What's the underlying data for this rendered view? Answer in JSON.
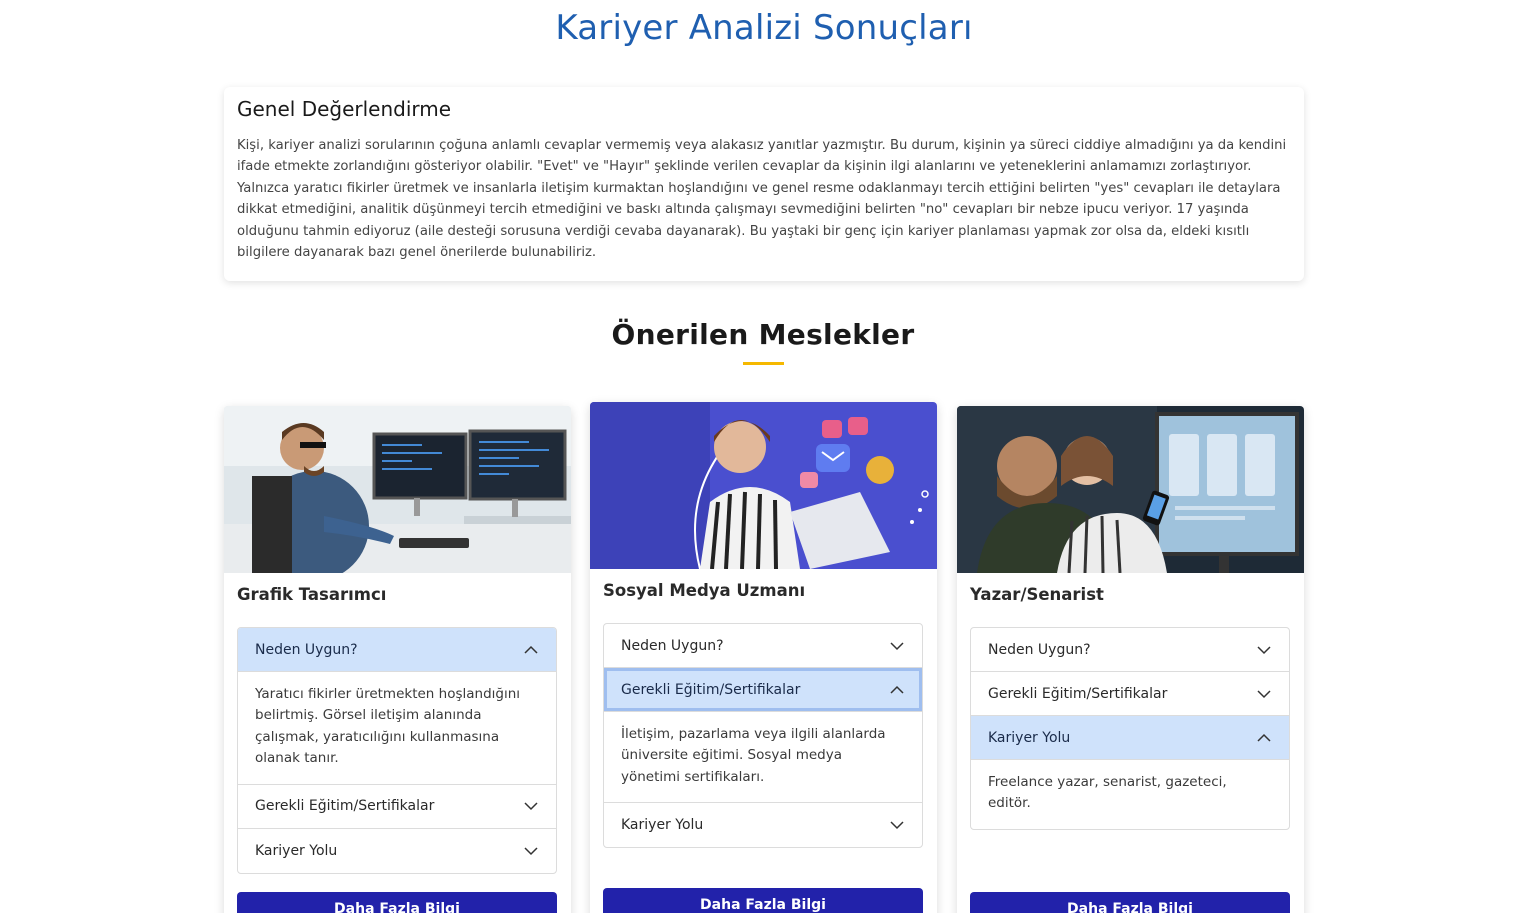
{
  "page": {
    "title": "Kariyer Analizi Sonuçları"
  },
  "summary": {
    "heading": "Genel Değerlendirme",
    "text": "Kişi, kariyer analizi sorularının çoğuna anlamlı cevaplar vermemiş veya alakasız yanıtlar yazmıştır. Bu durum, kişinin ya süreci ciddiye almadığını ya da kendini ifade etmekte zorlandığını gösteriyor olabilir. \"Evet\" ve \"Hayır\" şeklinde verilen cevaplar da kişinin ilgi alanlarını ve yeteneklerini anlamamızı zorlaştırıyor. Yalnızca yaratıcı fikirler üretmek ve insanlarla iletişim kurmaktan hoşlandığını ve genel resme odaklanmayı tercih ettiğini belirten \"yes\" cevapları ile detaylara dikkat etmediğini, analitik düşünmeyi tercih etmediğini ve baskı altında çalışmayı sevmediğini belirten \"no\" cevapları bir nebze ipucu veriyor. 17 yaşında olduğunu tahmin ediyoruz (aile desteği sorusuna verdiği cevaba dayanarak). Bu yaştaki bir genç için kariyer planlaması yapmak zor olsa da, eldeki kısıtlı bilgilere dayanarak bazı genel önerilerde bulunabiliriz."
  },
  "section": {
    "title": "Önerilen Meslekler"
  },
  "colors": {
    "accent": "#1f5fb0",
    "underline": "#f5b800",
    "button": "#2222aa",
    "open_header": "#cfe2fb"
  },
  "cards": [
    {
      "title": "Grafik Tasarımcı",
      "acc1_label": "Neden Uygun?",
      "acc1_body": "Yaratıcı fikirler üretmekten hoşlandığını belirtmiş. Görsel iletişim alanında çalışmak, yaratıcılığını kullanmasına olanak tanır.",
      "acc2_label": "Gerekli Eğitim/Sertifikalar",
      "acc3_label": "Kariyer Yolu",
      "button": "Daha Fazla Bilgi"
    },
    {
      "title": "Sosyal Medya Uzmanı",
      "acc1_label": "Neden Uygun?",
      "acc2_label": "Gerekli Eğitim/Sertifikalar",
      "acc2_body": "İletişim, pazarlama veya ilgili alanlarda üniversite eğitimi. Sosyal medya yönetimi sertifikaları.",
      "acc3_label": "Kariyer Yolu",
      "button": "Daha Fazla Bilgi"
    },
    {
      "title": "Yazar/Senarist",
      "acc1_label": "Neden Uygun?",
      "acc2_label": "Gerekli Eğitim/Sertifikalar",
      "acc3_label": "Kariyer Yolu",
      "acc3_body": "Freelance yazar, senarist, gazeteci, editör.",
      "button": "Daha Fazla Bilgi"
    }
  ],
  "icons": {
    "collapsed": "chevron-down-icon",
    "expanded": "chevron-up-icon"
  }
}
